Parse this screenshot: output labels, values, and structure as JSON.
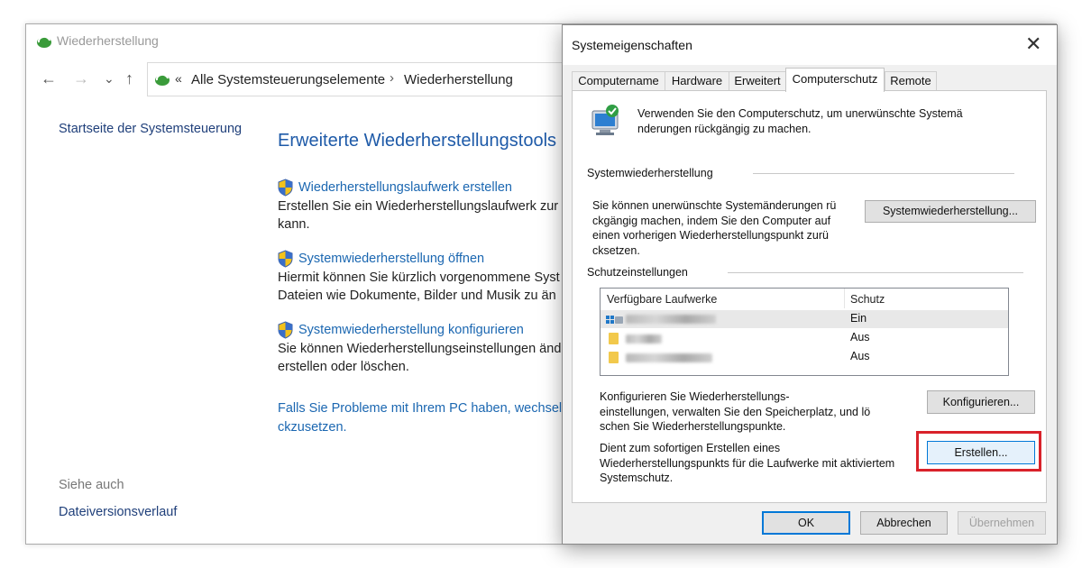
{
  "control_panel": {
    "window_title": "Wiederherstellung",
    "address": {
      "chevrons": "«",
      "crumb1": "Alle Systemsteuerungselemente",
      "sep": "›",
      "crumb2": "Wiederherstellung"
    },
    "nav": {
      "back": "←",
      "forward": "→",
      "down": "⌄",
      "up": "↑"
    },
    "home_link": "Startseite der Systemsteuerung",
    "heading": "Erweiterte Wiederherstellungstools",
    "tools": [
      {
        "link": "Wiederherstellungslaufwerk erstellen",
        "line1": "Erstellen Sie ein Wiederherstellungslaufwerk zur",
        "line2": "kann."
      },
      {
        "link": "Systemwiederherstellung öffnen",
        "line1": "Hiermit können Sie kürzlich vorgenommene Syst",
        "line2": "Dateien wie Dokumente, Bilder und Musik zu än"
      },
      {
        "link": "Systemwiederherstellung konfigurieren",
        "line1": "Sie können Wiederherstellungseinstellungen änd",
        "line2": "erstellen oder löschen."
      }
    ],
    "problem_line1": "Falls Sie Probleme mit Ihrem PC haben, wechselr",
    "problem_line2": "ckzusetzen.",
    "see_also": "Siehe auch",
    "history_link": "Dateiversionsverlauf"
  },
  "dialog": {
    "title": "Systemeigenschaften",
    "close": "✕",
    "tabs": [
      "Computername",
      "Hardware",
      "Erweitert",
      "Computerschutz",
      "Remote"
    ],
    "intro_line1": "Verwenden Sie den Computerschutz, um unerwünschte Systemä",
    "intro_line2": "nderungen rückgängig zu machen.",
    "restore_section": "Systemwiederherstellung",
    "restore_text": [
      "Sie können unerwünschte Systemänderungen rü",
      "ckgängig machen, indem Sie den Computer auf",
      "einen vorherigen Wiederherstellungspunkt zurü",
      "cksetzen."
    ],
    "restore_button": "Systemwiederherstellung...",
    "protection_section": "Schutzeinstellungen",
    "list": {
      "col_drive": "Verfügbare Laufwerke",
      "col_protection": "Schutz",
      "rows": [
        {
          "status": "Ein"
        },
        {
          "status": "Aus"
        },
        {
          "status": "Aus"
        }
      ]
    },
    "configure_text": [
      "Konfigurieren Sie Wiederherstellungs-",
      "einstellungen, verwalten Sie den Speicherplatz, und lö",
      "schen Sie Wiederherstellungspunkte."
    ],
    "configure_button": "Konfigurieren...",
    "create_text": [
      "Dient zum sofortigen Erstellen eines",
      "Wiederherstellungspunkts für die Laufwerke mit aktiviertem",
      "Systemschutz."
    ],
    "create_button": "Erstellen...",
    "ok": "OK",
    "cancel": "Abbrechen",
    "apply": "Übernehmen"
  },
  "colors": {
    "link": "#1b67b1",
    "heading": "#1e5aa8",
    "highlight": "#d9222a",
    "default_button_border": "#0078d7"
  }
}
